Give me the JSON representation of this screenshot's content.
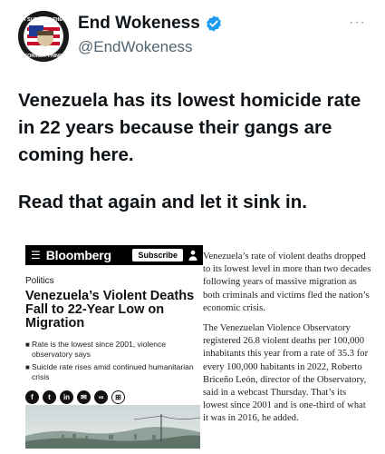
{
  "account": {
    "display_name": "End Wokeness",
    "handle": "@EndWokeness",
    "avatar_text_top": "I SUPPORT THE",
    "avatar_text_bottom": "FORMER THING"
  },
  "tweet": {
    "paragraphs": [
      "Venezuela has its lowest homicide rate in 22 years because their gangs are coming here.",
      "Read that again and let it sink in."
    ]
  },
  "article": {
    "brand": "Bloomberg",
    "subscribe_label": "Subscribe",
    "category": "Politics",
    "headline": "Venezuela’s Violent Deaths Fall to 22-Year Low on Migration",
    "bullets": [
      "Rate is the lowest since 2001, violence observatory says",
      "Suicide rate rises amid continued humanitarian crisis"
    ],
    "share_icons": [
      "facebook-icon",
      "twitter-icon",
      "linkedin-icon",
      "email-icon",
      "link-icon",
      "gift-icon"
    ],
    "body": [
      "Venezuela’s rate of violent deaths dropped to its lowest level in more than two decades following years of massive migration as both criminals and victims fled the nation’s economic crisis.",
      "The Venezuelan Violence Observatory registered 26.8 violent deaths per 100,000 inhabitants this year from a rate of 35.3 for every 100,000 habitants in 2022, Roberto Briceño León, director of the Observatory, said in a webcast Thursday. That’s its lowest since 2001 and is one-third of what it was in 2016, he added."
    ]
  },
  "colors": {
    "verified_blue": "#1d9bf0",
    "text_primary": "#0f1419",
    "text_secondary": "#536471"
  }
}
